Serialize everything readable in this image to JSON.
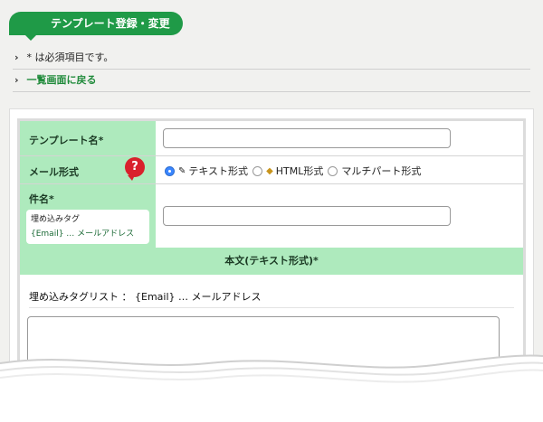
{
  "header": {
    "title": "テンプレート登録・変更"
  },
  "notes": {
    "required": "* は必須項目です。",
    "back_link": "一覧画面に戻る"
  },
  "form": {
    "template_name_label": "テンプレート名*",
    "template_name_value": "",
    "mail_format_label": "メール形式",
    "help_icon": "?",
    "mail_formats": [
      {
        "label": "テキスト形式",
        "selected": true,
        "icon": "pencil-icon"
      },
      {
        "label": "HTML形式",
        "selected": false,
        "icon": "palette-icon"
      },
      {
        "label": "マルチパート形式",
        "selected": false,
        "icon": ""
      }
    ],
    "subject_label": "件名*",
    "embed_tag_title": "埋め込みタグ",
    "embed_tag_item": "{Email} … メールアドレス",
    "subject_value": "",
    "body_label": "本文(テキスト形式)*",
    "taglist": "埋め込みタグリスト ： {Email} … メールアドレス",
    "body_value": ""
  }
}
